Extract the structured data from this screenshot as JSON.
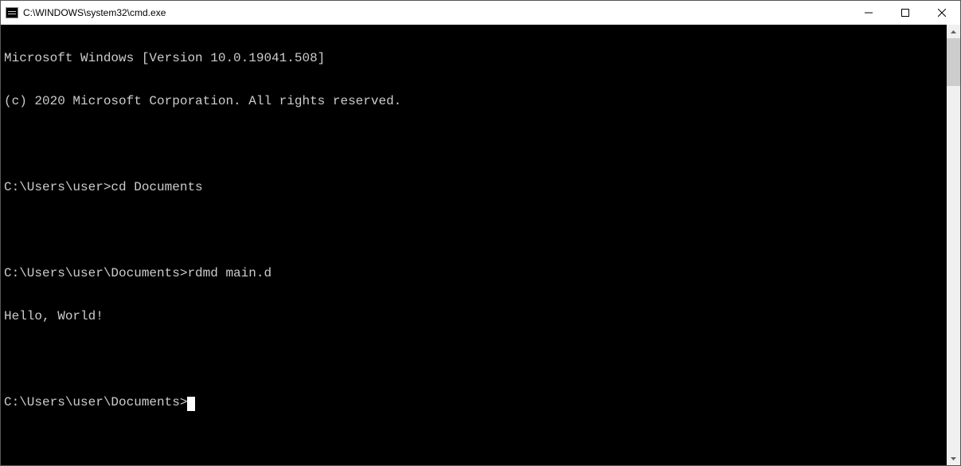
{
  "window": {
    "title": "C:\\WINDOWS\\system32\\cmd.exe"
  },
  "terminal": {
    "banner_line1": "Microsoft Windows [Version 10.0.19041.508]",
    "banner_line2": "(c) 2020 Microsoft Corporation. All rights reserved.",
    "entries": [
      {
        "prompt": "C:\\Users\\user>",
        "command": "cd Documents",
        "output": ""
      },
      {
        "prompt": "C:\\Users\\user\\Documents>",
        "command": "rdmd main.d",
        "output": "Hello, World!"
      }
    ],
    "current_prompt": "C:\\Users\\user\\Documents>"
  }
}
